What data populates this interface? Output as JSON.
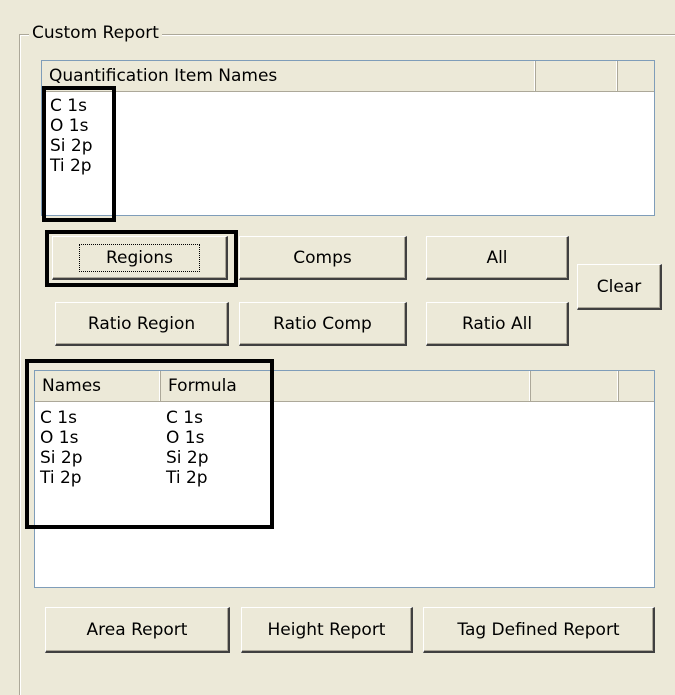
{
  "group": {
    "title": "Custom Report"
  },
  "top_list": {
    "header": "Quantification Item Names",
    "rows": [
      "C 1s",
      "O 1s",
      "Si 2p",
      "Ti 2p"
    ]
  },
  "buttons": {
    "regions": "Regions",
    "comps": "Comps",
    "all": "All",
    "clear": "Clear",
    "ratio_region": "Ratio Region",
    "ratio_comp": "Ratio Comp",
    "ratio_all": "Ratio All",
    "area_report": "Area Report",
    "height_report": "Height Report",
    "tag_defined_report": "Tag Defined Report"
  },
  "bottom_list": {
    "headers": [
      "Names",
      "Formula"
    ],
    "rows": [
      {
        "name": "C 1s",
        "formula": "C 1s"
      },
      {
        "name": "O 1s",
        "formula": "O 1s"
      },
      {
        "name": "Si 2p",
        "formula": "Si 2p"
      },
      {
        "name": "Ti 2p",
        "formula": "Ti 2p"
      }
    ]
  }
}
